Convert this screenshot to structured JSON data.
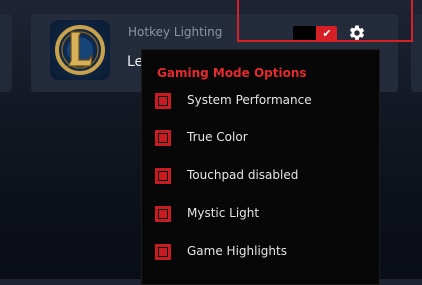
{
  "card": {
    "hotkey_label": "Hotkey Lighting",
    "game_name": "Le",
    "logo_icon": "league-of-legends-logo"
  },
  "toggle": {
    "state": "on",
    "check_icon": "checkmark-icon",
    "check_glyph": "✔"
  },
  "settings": {
    "icon": "gear-icon"
  },
  "dropdown": {
    "title": "Gaming Mode Options",
    "options": [
      {
        "label": "System Performance",
        "checked": true
      },
      {
        "label": "True Color",
        "checked": true
      },
      {
        "label": "Touchpad disabled",
        "checked": true
      },
      {
        "label": "Mystic Light",
        "checked": true
      },
      {
        "label": "Game Highlights",
        "checked": true
      }
    ]
  },
  "colors": {
    "accent": "#d61f26",
    "title_red": "#e32a2f",
    "dropdown_bg": "#070707",
    "card_bg": "#242b3a"
  }
}
